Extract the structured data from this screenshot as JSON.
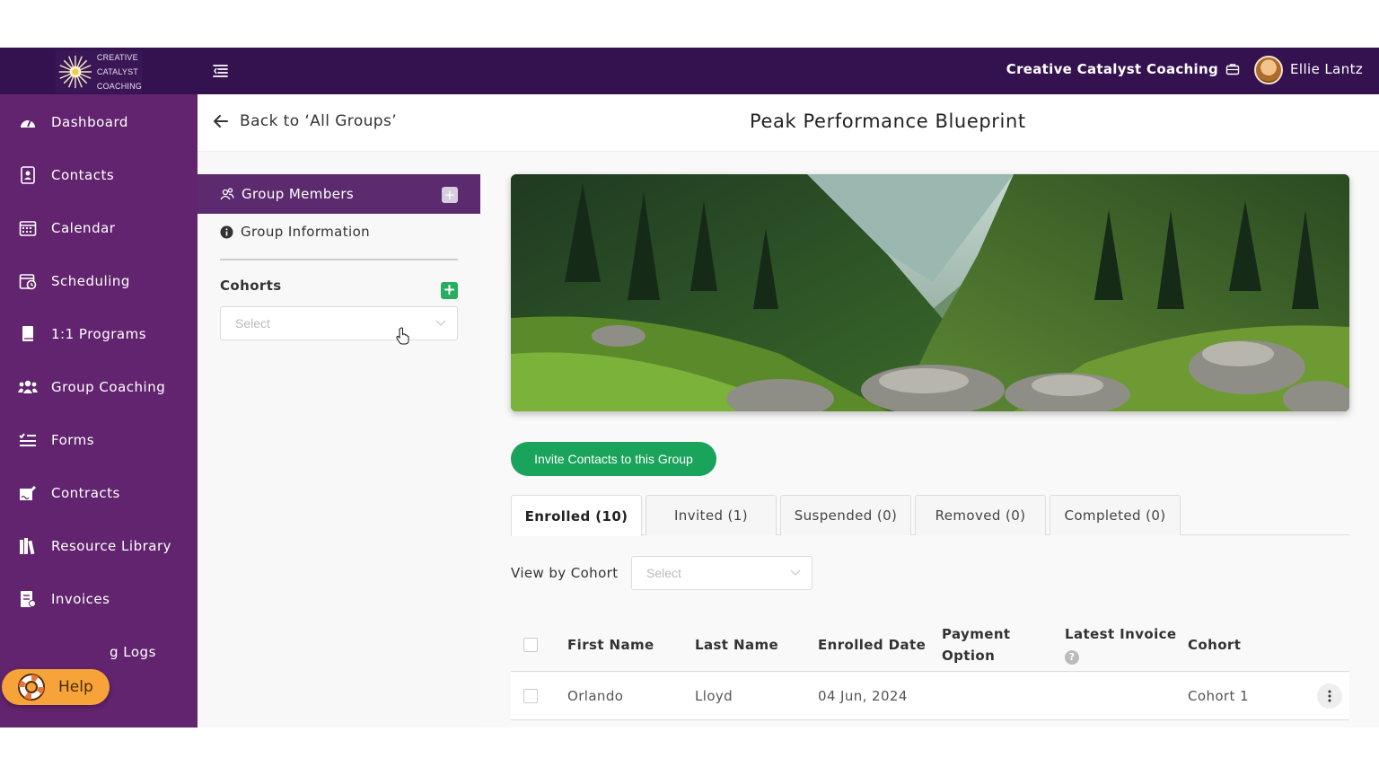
{
  "logo": {
    "line1": "CREATIVE",
    "line2": "CATALYST",
    "line3": "COACHING"
  },
  "header": {
    "company": "Creative Catalyst Coaching",
    "user": "Ellie Lantz"
  },
  "sidebar": {
    "items": [
      {
        "label": "Dashboard",
        "icon": "dashboard-icon"
      },
      {
        "label": "Contacts",
        "icon": "contacts-icon"
      },
      {
        "label": "Calendar",
        "icon": "calendar-icon"
      },
      {
        "label": "Scheduling",
        "icon": "scheduling-icon"
      },
      {
        "label": "1:1 Programs",
        "icon": "book-icon"
      },
      {
        "label": "Group Coaching",
        "icon": "users-icon"
      },
      {
        "label": "Forms",
        "icon": "list-icon"
      },
      {
        "label": "Contracts",
        "icon": "signature-icon"
      },
      {
        "label": "Resource Library",
        "icon": "library-icon"
      },
      {
        "label": "Invoices",
        "icon": "invoice-icon"
      },
      {
        "label": "g Logs",
        "icon": ""
      }
    ],
    "help_label": "Help"
  },
  "page": {
    "back_label": "Back to ‘All Groups’",
    "title": "Peak Performance Blueprint"
  },
  "left_panel": {
    "group_members": "Group Members",
    "group_information": "Group Information",
    "cohorts_label": "Cohorts",
    "cohort_select_placeholder": "Select"
  },
  "content": {
    "invite_button": "Invite Contacts to this Group",
    "tabs": [
      {
        "label": "Enrolled (10)",
        "active": true
      },
      {
        "label": "Invited (1)",
        "active": false
      },
      {
        "label": "Suspended (0)",
        "active": false
      },
      {
        "label": "Removed (0)",
        "active": false
      },
      {
        "label": "Completed (0)",
        "active": false
      }
    ],
    "view_by_cohort_label": "View by Cohort",
    "view_by_cohort_placeholder": "Select",
    "table": {
      "headers": {
        "first_name": "First Name",
        "last_name": "Last Name",
        "enrolled_date": "Enrolled Date",
        "payment_line1": "Payment",
        "payment_line2": "Option",
        "latest_invoice": "Latest Invoice",
        "cohort": "Cohort"
      },
      "rows": [
        {
          "first_name": "Orlando",
          "last_name": "Lloyd",
          "enrolled_date": "04 Jun, 2024",
          "payment_option": "",
          "latest_invoice": "",
          "cohort": "Cohort 1"
        }
      ]
    }
  },
  "colors": {
    "topbar": "#34124f",
    "sidebar": "#62246f",
    "active_panel": "#5c2a6e",
    "invite_green": "#1aa35b",
    "help_orange": "#f6a43a"
  }
}
